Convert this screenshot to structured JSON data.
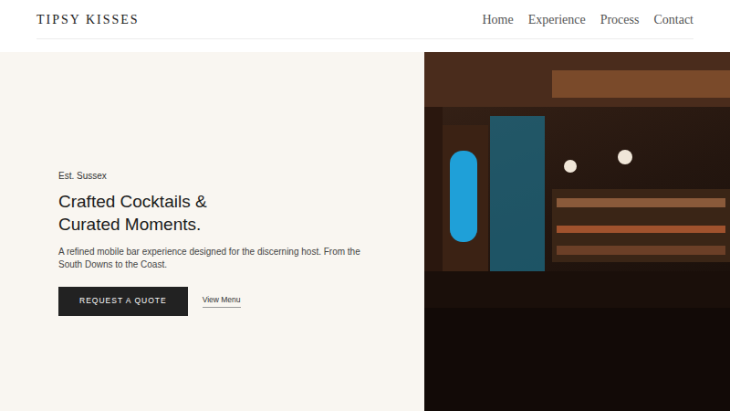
{
  "brand": "TIPSY KISSES",
  "nav": [
    {
      "label": "Home"
    },
    {
      "label": "Experience"
    },
    {
      "label": "Process"
    },
    {
      "label": "Contact"
    }
  ],
  "hero": {
    "eyebrow": "Est. Sussex",
    "title_lines": [
      "Crafted Cocktails &",
      "Curated Moments."
    ],
    "text": "A refined mobile bar experience designed for the discerning host. From the South Downs to the Coast.",
    "primary_button": "REQUEST A QUOTE",
    "secondary_link": "View Menu"
  }
}
